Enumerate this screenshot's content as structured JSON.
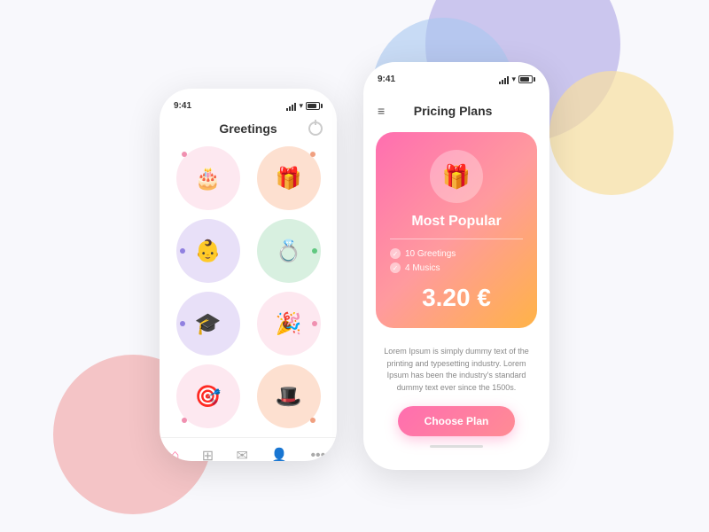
{
  "background": {
    "blob_purple": "visible",
    "blob_blue": "visible",
    "blob_yellow": "visible",
    "blob_pink": "visible"
  },
  "phone1": {
    "status_time": "9:41",
    "title": "Greetings",
    "icons": [
      {
        "name": "birthday",
        "bg": "#fde8f0",
        "icon": "🎂",
        "dot_color": "#f090b0",
        "dot_pos": "top-left"
      },
      {
        "name": "gift",
        "bg": "#fde0d0",
        "icon": "🎁",
        "dot_color": "#f0a080",
        "dot_pos": "top-right"
      },
      {
        "name": "baby",
        "bg": "#e8e0f8",
        "icon": "👶",
        "dot_color": "#9080e0",
        "dot_pos": "left"
      },
      {
        "name": "rings",
        "bg": "#d8f0e0",
        "icon": "💍",
        "dot_color": "#60c880",
        "dot_pos": "right"
      },
      {
        "name": "graduation",
        "bg": "#e8e0f8",
        "icon": "🎓",
        "dot_color": "#9080e0",
        "dot_pos": "left"
      },
      {
        "name": "party",
        "bg": "#fde8f0",
        "icon": "🎉",
        "dot_color": "#f090b0",
        "dot_pos": "right"
      },
      {
        "name": "target",
        "bg": "#fde8f0",
        "icon": "🎯",
        "dot_color": "#f090b0",
        "dot_pos": "bottom"
      },
      {
        "name": "hat",
        "bg": "#fde0d0",
        "icon": "🎩",
        "dot_color": "#f0a080",
        "dot_pos": "bottom"
      }
    ],
    "nav_items": [
      "home",
      "grid",
      "mail",
      "person",
      "more"
    ]
  },
  "phone2": {
    "status_time": "9:41",
    "title": "Pricing Plans",
    "card": {
      "icon": "🎁",
      "label": "Most Popular",
      "features": [
        "10 Greetings",
        "4 Musics"
      ],
      "price": "3.20 €"
    },
    "description": "Lorem Ipsum is simply dummy text of the printing and typesetting industry. Lorem Ipsum has been the industry's standard dummy text ever since the 1500s.",
    "button_label": "Choose Plan"
  }
}
